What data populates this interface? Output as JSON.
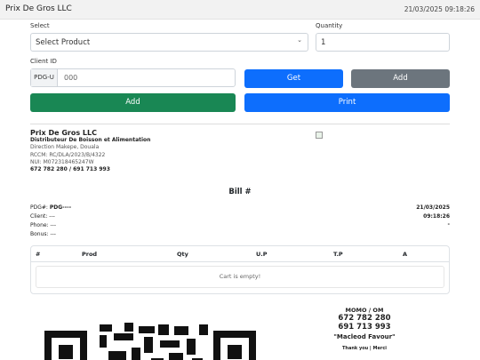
{
  "header": {
    "app_title": "Prix De Gros LLC",
    "datetime": "21/03/2025 09:18:26"
  },
  "form": {
    "select_label": "Select",
    "product_placeholder": "Select Product",
    "quantity_label": "Quantity",
    "quantity_value": "1",
    "client_label": "Client ID",
    "client_prefix": "PDG-U",
    "client_value": "000",
    "get_label": "Get",
    "add_client_label": "Add",
    "add_label": "Add",
    "print_label": "Print"
  },
  "receipt": {
    "company_name": "Prix De Gros LLC",
    "description": "Distributeur De Boisson et Alimentation",
    "address": "Direction Makepe, Douala",
    "rccm": "RCCM: RC/DLA/2023/B/4322",
    "nui": "NUI: M072318465247W",
    "phones": "672 782 280 / 691 713 993",
    "bill_title": "Bill #",
    "pdg_label": "PDG#:",
    "pdg_value": "PDG----",
    "client": "Client: ---",
    "phone": "Phone: ---",
    "bonus": "Bonus: ---",
    "date": "21/03/2025",
    "time": "09:18:26",
    "dash": "-"
  },
  "cart": {
    "columns": [
      "#",
      "Prod",
      "Qty",
      "U.P",
      "T.P",
      "A"
    ],
    "empty_message": "Cart is empty!"
  },
  "payment": {
    "title": "MOMO / OM",
    "phone1": "672 782 280",
    "phone2": "691 713 993",
    "name": "\"Macleod Favour\"",
    "thanks": "Thank you | Merci"
  }
}
